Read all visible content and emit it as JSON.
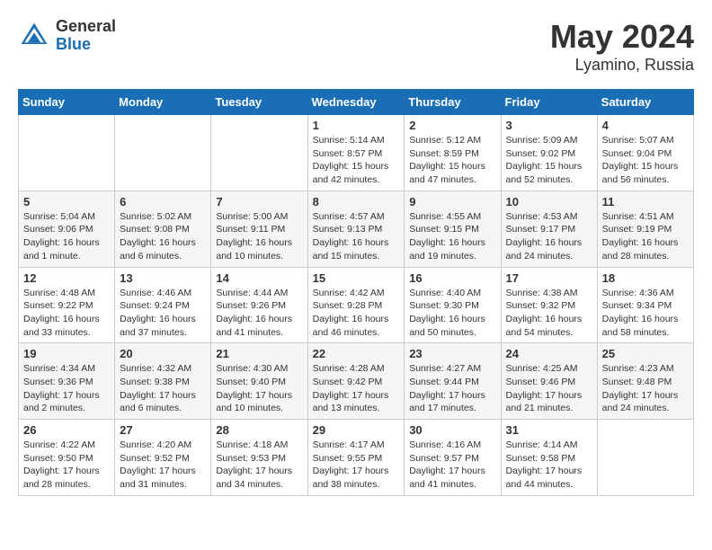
{
  "logo": {
    "general": "General",
    "blue": "Blue"
  },
  "title": {
    "month": "May 2024",
    "location": "Lyamino, Russia"
  },
  "weekdays": [
    "Sunday",
    "Monday",
    "Tuesday",
    "Wednesday",
    "Thursday",
    "Friday",
    "Saturday"
  ],
  "weeks": [
    [
      {
        "day": "",
        "info": ""
      },
      {
        "day": "",
        "info": ""
      },
      {
        "day": "",
        "info": ""
      },
      {
        "day": "1",
        "info": "Sunrise: 5:14 AM\nSunset: 8:57 PM\nDaylight: 15 hours\nand 42 minutes."
      },
      {
        "day": "2",
        "info": "Sunrise: 5:12 AM\nSunset: 8:59 PM\nDaylight: 15 hours\nand 47 minutes."
      },
      {
        "day": "3",
        "info": "Sunrise: 5:09 AM\nSunset: 9:02 PM\nDaylight: 15 hours\nand 52 minutes."
      },
      {
        "day": "4",
        "info": "Sunrise: 5:07 AM\nSunset: 9:04 PM\nDaylight: 15 hours\nand 56 minutes."
      }
    ],
    [
      {
        "day": "5",
        "info": "Sunrise: 5:04 AM\nSunset: 9:06 PM\nDaylight: 16 hours\nand 1 minute."
      },
      {
        "day": "6",
        "info": "Sunrise: 5:02 AM\nSunset: 9:08 PM\nDaylight: 16 hours\nand 6 minutes."
      },
      {
        "day": "7",
        "info": "Sunrise: 5:00 AM\nSunset: 9:11 PM\nDaylight: 16 hours\nand 10 minutes."
      },
      {
        "day": "8",
        "info": "Sunrise: 4:57 AM\nSunset: 9:13 PM\nDaylight: 16 hours\nand 15 minutes."
      },
      {
        "day": "9",
        "info": "Sunrise: 4:55 AM\nSunset: 9:15 PM\nDaylight: 16 hours\nand 19 minutes."
      },
      {
        "day": "10",
        "info": "Sunrise: 4:53 AM\nSunset: 9:17 PM\nDaylight: 16 hours\nand 24 minutes."
      },
      {
        "day": "11",
        "info": "Sunrise: 4:51 AM\nSunset: 9:19 PM\nDaylight: 16 hours\nand 28 minutes."
      }
    ],
    [
      {
        "day": "12",
        "info": "Sunrise: 4:48 AM\nSunset: 9:22 PM\nDaylight: 16 hours\nand 33 minutes."
      },
      {
        "day": "13",
        "info": "Sunrise: 4:46 AM\nSunset: 9:24 PM\nDaylight: 16 hours\nand 37 minutes."
      },
      {
        "day": "14",
        "info": "Sunrise: 4:44 AM\nSunset: 9:26 PM\nDaylight: 16 hours\nand 41 minutes."
      },
      {
        "day": "15",
        "info": "Sunrise: 4:42 AM\nSunset: 9:28 PM\nDaylight: 16 hours\nand 46 minutes."
      },
      {
        "day": "16",
        "info": "Sunrise: 4:40 AM\nSunset: 9:30 PM\nDaylight: 16 hours\nand 50 minutes."
      },
      {
        "day": "17",
        "info": "Sunrise: 4:38 AM\nSunset: 9:32 PM\nDaylight: 16 hours\nand 54 minutes."
      },
      {
        "day": "18",
        "info": "Sunrise: 4:36 AM\nSunset: 9:34 PM\nDaylight: 16 hours\nand 58 minutes."
      }
    ],
    [
      {
        "day": "19",
        "info": "Sunrise: 4:34 AM\nSunset: 9:36 PM\nDaylight: 17 hours\nand 2 minutes."
      },
      {
        "day": "20",
        "info": "Sunrise: 4:32 AM\nSunset: 9:38 PM\nDaylight: 17 hours\nand 6 minutes."
      },
      {
        "day": "21",
        "info": "Sunrise: 4:30 AM\nSunset: 9:40 PM\nDaylight: 17 hours\nand 10 minutes."
      },
      {
        "day": "22",
        "info": "Sunrise: 4:28 AM\nSunset: 9:42 PM\nDaylight: 17 hours\nand 13 minutes."
      },
      {
        "day": "23",
        "info": "Sunrise: 4:27 AM\nSunset: 9:44 PM\nDaylight: 17 hours\nand 17 minutes."
      },
      {
        "day": "24",
        "info": "Sunrise: 4:25 AM\nSunset: 9:46 PM\nDaylight: 17 hours\nand 21 minutes."
      },
      {
        "day": "25",
        "info": "Sunrise: 4:23 AM\nSunset: 9:48 PM\nDaylight: 17 hours\nand 24 minutes."
      }
    ],
    [
      {
        "day": "26",
        "info": "Sunrise: 4:22 AM\nSunset: 9:50 PM\nDaylight: 17 hours\nand 28 minutes."
      },
      {
        "day": "27",
        "info": "Sunrise: 4:20 AM\nSunset: 9:52 PM\nDaylight: 17 hours\nand 31 minutes."
      },
      {
        "day": "28",
        "info": "Sunrise: 4:18 AM\nSunset: 9:53 PM\nDaylight: 17 hours\nand 34 minutes."
      },
      {
        "day": "29",
        "info": "Sunrise: 4:17 AM\nSunset: 9:55 PM\nDaylight: 17 hours\nand 38 minutes."
      },
      {
        "day": "30",
        "info": "Sunrise: 4:16 AM\nSunset: 9:57 PM\nDaylight: 17 hours\nand 41 minutes."
      },
      {
        "day": "31",
        "info": "Sunrise: 4:14 AM\nSunset: 9:58 PM\nDaylight: 17 hours\nand 44 minutes."
      },
      {
        "day": "",
        "info": ""
      }
    ]
  ]
}
